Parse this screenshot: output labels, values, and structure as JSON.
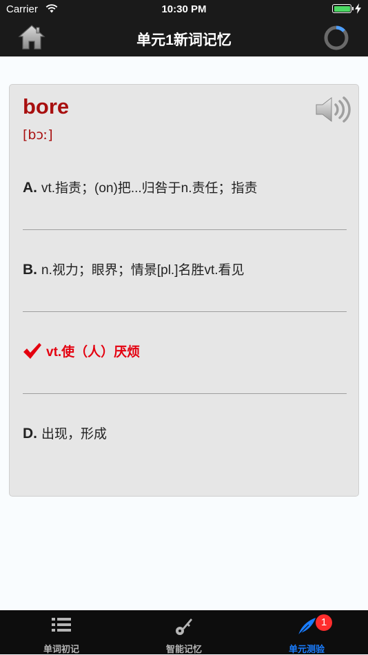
{
  "status_bar": {
    "carrier": "Carrier",
    "time": "10:30 PM"
  },
  "nav": {
    "title": "单元1新词记忆"
  },
  "card": {
    "word": "bore",
    "phonetic": "[bɔː]",
    "options": [
      {
        "letter": "A.",
        "text": "vt.指责；(on)把...归咎于n.责任；指责",
        "state": "normal"
      },
      {
        "letter": "B.",
        "text": "n.视力；眼界；情景[pl.]名胜vt.看见",
        "state": "normal"
      },
      {
        "letter": "",
        "text": "vt.使（人）厌烦",
        "state": "correct"
      },
      {
        "letter": "D.",
        "text": "出现，形成",
        "state": "normal"
      }
    ]
  },
  "tabs": [
    {
      "label": "单词初记",
      "icon": "list-icon"
    },
    {
      "label": "智能记忆",
      "icon": "key-icon"
    },
    {
      "label": "单元测验",
      "icon": "feather-icon",
      "badge": "1",
      "active": true
    }
  ],
  "colors": {
    "accent": "#1a7dff",
    "word": "#a80f0f",
    "correct": "#e4000f",
    "bar": "#1a1a1a"
  }
}
